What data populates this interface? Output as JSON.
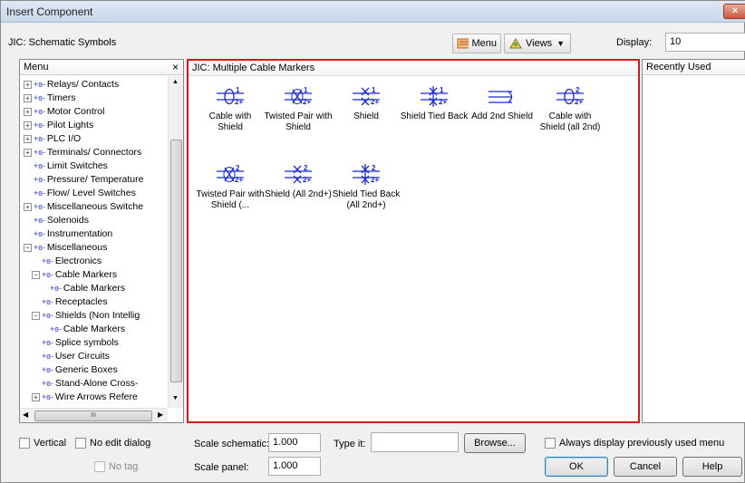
{
  "window": {
    "title": "Insert Component",
    "close_glyph": "×"
  },
  "header": {
    "library_title": "JIC: Schematic Symbols",
    "menu_button": "Menu",
    "views_button": "Views",
    "display_label": "Display:",
    "display_value": "10"
  },
  "menu_panel": {
    "title": "Menu",
    "close_glyph": "×",
    "items": [
      {
        "label": "Relays/ Contacts",
        "expander": "+",
        "indent": 1
      },
      {
        "label": "Timers",
        "expander": "+",
        "indent": 1
      },
      {
        "label": "Motor Control",
        "expander": "+",
        "indent": 1
      },
      {
        "label": "Pilot Lights",
        "expander": "+",
        "indent": 1
      },
      {
        "label": "PLC I/O",
        "expander": "+",
        "indent": 1
      },
      {
        "label": "Terminals/ Connectors",
        "expander": "+",
        "indent": 1
      },
      {
        "label": "Limit Switches",
        "expander": "",
        "indent": 1
      },
      {
        "label": "Pressure/ Temperature",
        "expander": "",
        "indent": 1
      },
      {
        "label": "Flow/ Level Switches",
        "expander": "",
        "indent": 1
      },
      {
        "label": "Miscellaneous Switche",
        "expander": "+",
        "indent": 1
      },
      {
        "label": "Solenoids",
        "expander": "",
        "indent": 1
      },
      {
        "label": "Instrumentation",
        "expander": "",
        "indent": 1
      },
      {
        "label": "Miscellaneous",
        "expander": "−",
        "indent": 1
      },
      {
        "label": "Electronics",
        "expander": "",
        "indent": 2
      },
      {
        "label": "Cable Markers",
        "expander": "−",
        "indent": 2
      },
      {
        "label": "Cable Markers",
        "expander": "",
        "indent": 3
      },
      {
        "label": "Receptacles",
        "expander": "",
        "indent": 2
      },
      {
        "label": "Shields (Non Intellig",
        "expander": "−",
        "indent": 2
      },
      {
        "label": "Cable Markers",
        "expander": "",
        "indent": 3
      },
      {
        "label": "Splice symbols",
        "expander": "",
        "indent": 2
      },
      {
        "label": "User Circuits",
        "expander": "",
        "indent": 2
      },
      {
        "label": "Generic Boxes",
        "expander": "",
        "indent": 2
      },
      {
        "label": "Stand-Alone Cross-",
        "expander": "",
        "indent": 2
      },
      {
        "label": "Wire Arrows Refere",
        "expander": "+",
        "indent": 2
      }
    ],
    "scroll_grip": "III"
  },
  "symbols_panel": {
    "title": "JIC: Multiple Cable Markers",
    "symbols": [
      {
        "label": "Cable with Shield",
        "icon": "cable-shield-icon"
      },
      {
        "label": "Twisted Pair with Shield",
        "icon": "twisted-pair-shield-icon"
      },
      {
        "label": "Shield",
        "icon": "shield-icon"
      },
      {
        "label": "Shield Tied Back",
        "icon": "shield-tied-back-icon"
      },
      {
        "label": "Add 2nd Shield",
        "icon": "add-2nd-shield-icon"
      },
      {
        "label": "Cable with Shield (all 2nd)",
        "icon": "cable-shield-all2nd-icon"
      },
      {
        "label": "Twisted Pair with Shield (...",
        "icon": "twisted-pair-shield-2nd-icon"
      },
      {
        "label": "Shield (All 2nd+)",
        "icon": "shield-all2nd-icon"
      },
      {
        "label": "Shield Tied Back (All 2nd+)",
        "icon": "shield-tied-back-all2nd-icon"
      }
    ]
  },
  "recent_panel": {
    "title": "Recently Used"
  },
  "footer": {
    "vertical_label": "Vertical",
    "no_edit_label": "No edit dialog",
    "no_tag_label": "No tag",
    "scale_schematic_label": "Scale schematic:",
    "scale_schematic_value": "1.000",
    "scale_panel_label": "Scale panel:",
    "scale_panel_value": "1.000",
    "type_it_label": "Type it:",
    "type_it_value": "",
    "browse_button": "Browse...",
    "always_display_label": "Always display previously used menu",
    "ok_button": "OK",
    "cancel_button": "Cancel",
    "help_button": "Help"
  },
  "colors": {
    "highlight_border": "#d11a1a",
    "symbol_blue": "#1a2bd6"
  }
}
